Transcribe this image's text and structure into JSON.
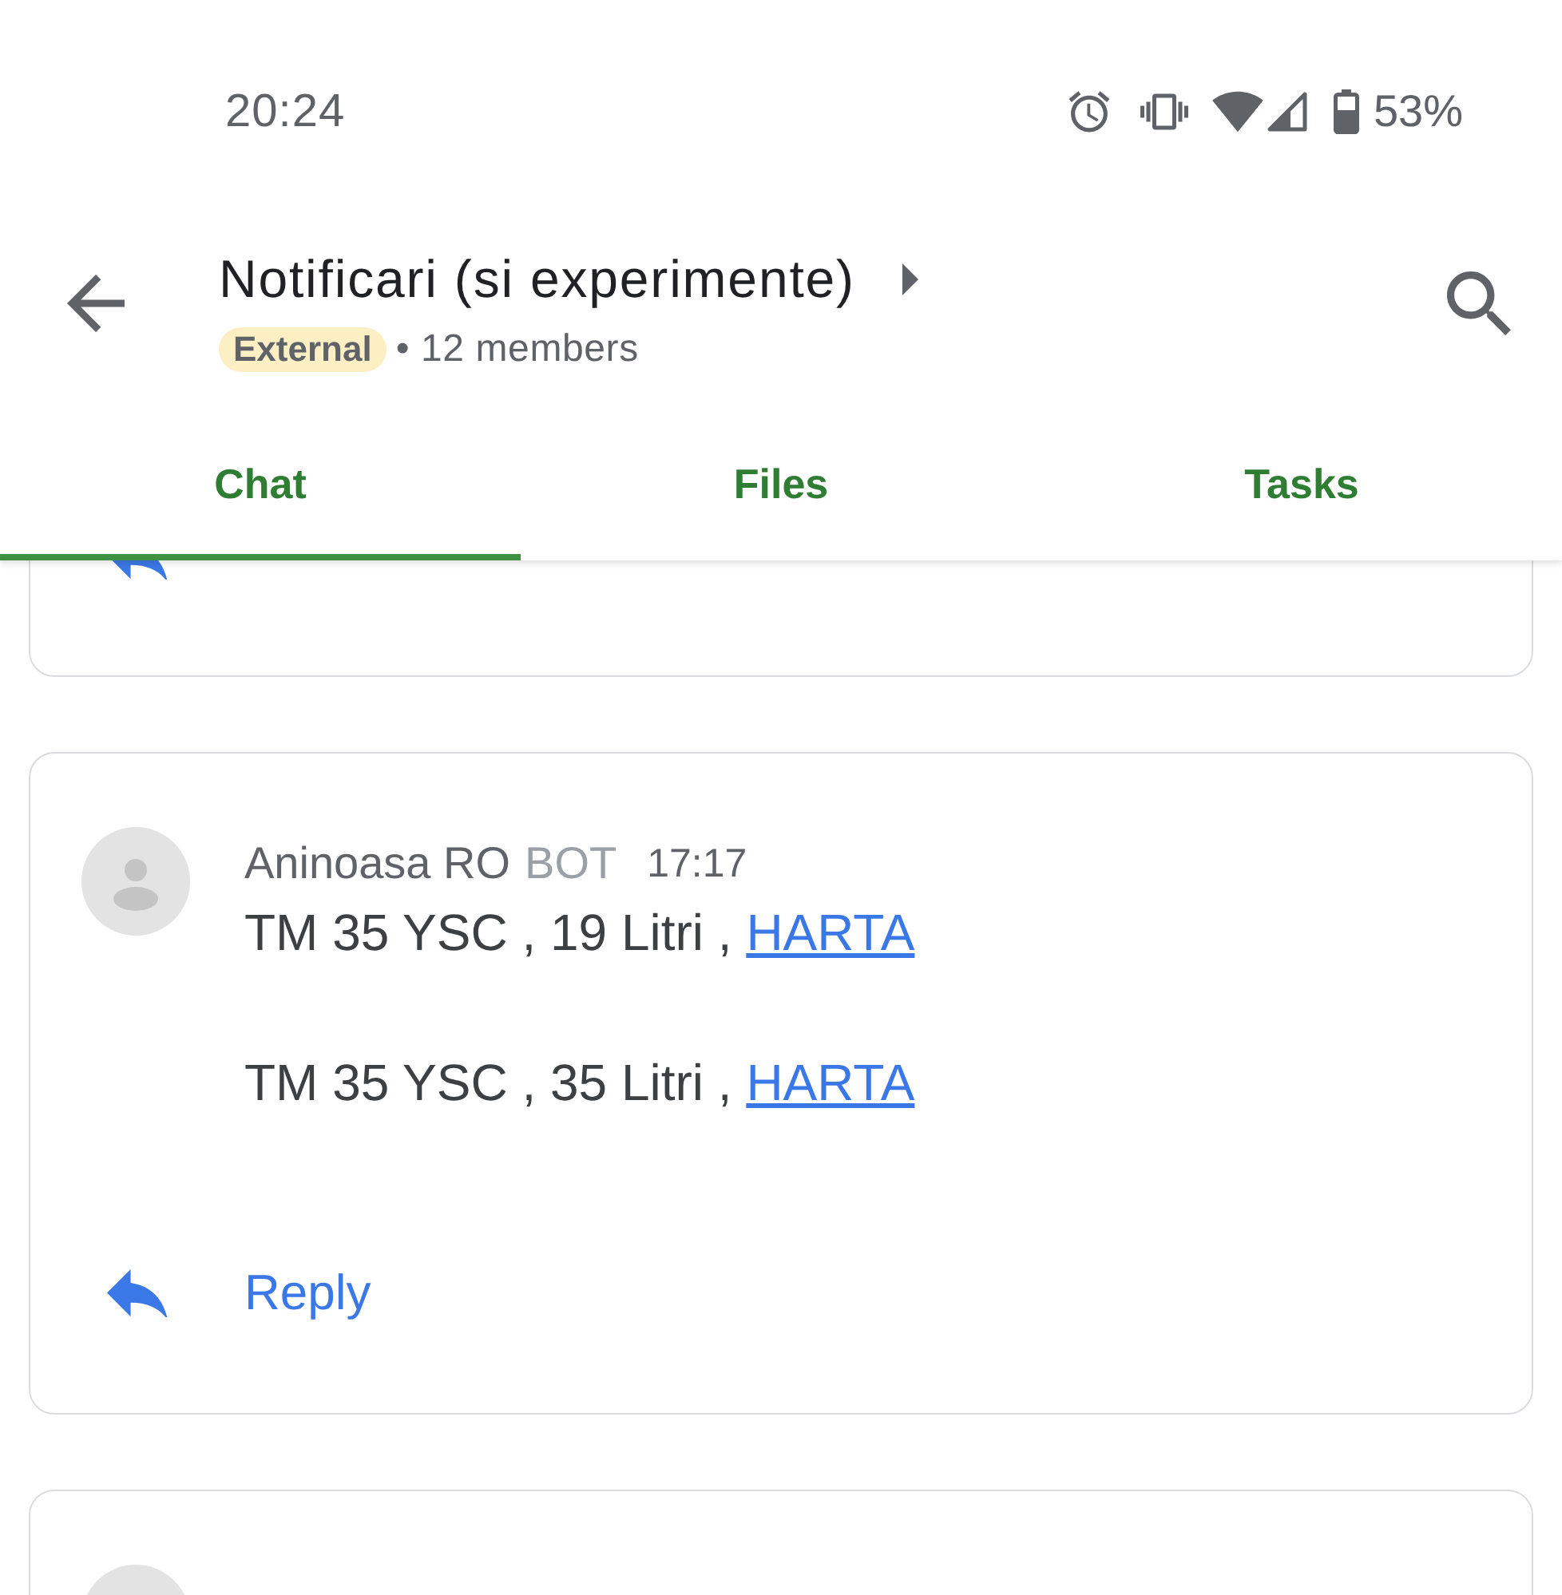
{
  "status_bar": {
    "time": "20:24",
    "battery": "53%"
  },
  "app_bar": {
    "title": "Notificari (si experimente)",
    "badge": "External",
    "members": "• 12 members"
  },
  "tabs": [
    {
      "label": "Chat",
      "selected": true
    },
    {
      "label": "Files",
      "selected": false
    },
    {
      "label": "Tasks",
      "selected": false
    }
  ],
  "messages": [
    {
      "kind": "tail"
    },
    {
      "kind": "full",
      "sender": "Aninoasa RO",
      "tag": "BOT",
      "time": "17:17",
      "lines": [
        {
          "text": "TM 35 YSC , 19 Litri ,",
          "link": "HARTA"
        },
        {
          "text": "TM 35 YSC , 35 Litri ,",
          "link": "HARTA"
        }
      ],
      "reply": "Reply"
    },
    {
      "kind": "head"
    }
  ]
}
